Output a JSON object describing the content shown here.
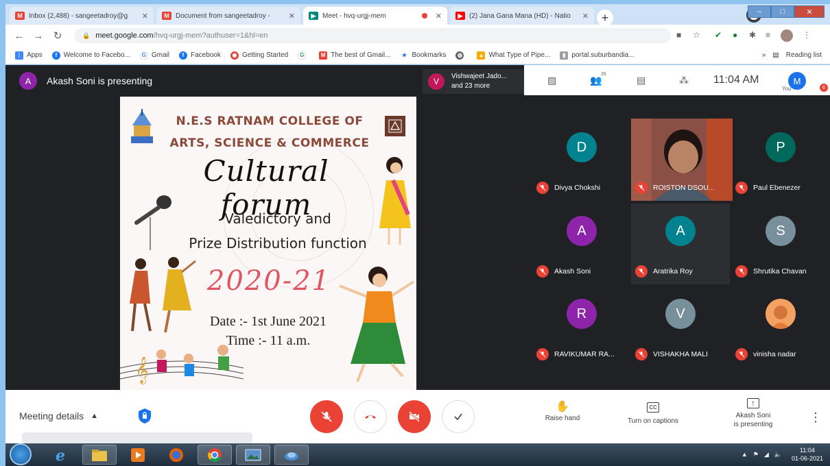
{
  "browser": {
    "tabs": [
      {
        "label": "Inbox (2,488) - sangeetadroy@g",
        "icon": "gmail-icon",
        "color": "#ea4335",
        "active": false
      },
      {
        "label": "Document from sangeetadroy -",
        "icon": "gmail-icon",
        "color": "#ea4335",
        "active": false
      },
      {
        "label": "Meet - hvq-urgj-mem",
        "icon": "meet-icon",
        "color": "#00897b",
        "active": true
      },
      {
        "label": "(2) Jana Gana Mana (HD) - Natio",
        "icon": "youtube-icon",
        "color": "#ff0000",
        "active": false
      }
    ],
    "url_host": "meet.google.com",
    "url_path": "/hvq-urgj-mem?authuser=1&hl=en",
    "bookmarks": [
      {
        "label": "Apps",
        "icon": "apps-icon",
        "color": "#4285f4"
      },
      {
        "label": "Welcome to Facebo...",
        "icon": "facebook-icon",
        "color": "#1877f2"
      },
      {
        "label": "Gmail",
        "icon": "google-icon",
        "color": "#4285f4"
      },
      {
        "label": "Facebook",
        "icon": "facebook-icon",
        "color": "#1877f2"
      },
      {
        "label": "Getting Started",
        "icon": "chrome-icon",
        "color": "#db4437"
      },
      {
        "label": "",
        "icon": "google-icon",
        "color": "#34a853"
      },
      {
        "label": "The best of Gmail...",
        "icon": "gmail-icon",
        "color": "#ea4335"
      },
      {
        "label": "Bookmarks",
        "icon": "star-icon",
        "color": "#1a73e8"
      },
      {
        "label": "",
        "icon": "globe-icon",
        "color": "#5f6368"
      },
      {
        "label": "What Type of Pipe...",
        "icon": "pipe-icon",
        "color": "#f9ab00"
      },
      {
        "label": "portal.suburbandia...",
        "icon": "portal-icon",
        "color": "#9aa0a6"
      }
    ],
    "reading_list": "Reading list"
  },
  "meet": {
    "presenter": {
      "initial": "A",
      "text": "Akash Soni is presenting",
      "color": "#8e24aa"
    },
    "others": {
      "initial": "V",
      "line1": "Vishwajeet Jado...",
      "line2": "and 23 more"
    },
    "participant_count": "26",
    "time": "11:04 AM",
    "you_initial": "M",
    "you_label": "You",
    "badge": "6",
    "slide": {
      "college_line1": "N.E.S RATNAM COLLEGE OF",
      "college_line2": "ARTS, SCIENCE & COMMERCE",
      "title": "Cultural forum",
      "subtitle_line1": "Valedictory and",
      "subtitle_line2": "Prize Distribution function",
      "year": "2020-21",
      "date": "Date :- 1st June 2021",
      "time": "Time :- 11 a.m."
    },
    "participants": [
      {
        "initial": "D",
        "name": "Divya Chokshi",
        "color": "#00838f",
        "video": false
      },
      {
        "initial": "",
        "name": "ROISTON DSOU...",
        "color": "#7a4a40",
        "video": true
      },
      {
        "initial": "P",
        "name": "Paul Ebenezer",
        "color": "#00695c",
        "video": false
      },
      {
        "initial": "A",
        "name": "Akash Soni",
        "color": "#8e24aa",
        "video": false
      },
      {
        "initial": "A",
        "name": "Aratrika Roy",
        "color": "#00838f",
        "video": false
      },
      {
        "initial": "S",
        "name": "Shrutika Chavan",
        "color": "#78909c",
        "video": false
      },
      {
        "initial": "R",
        "name": "RAVIKUMAR RA...",
        "color": "#8e24aa",
        "video": false
      },
      {
        "initial": "V",
        "name": "VISHAKHA MALI",
        "color": "#78909c",
        "video": false
      },
      {
        "initial": "",
        "name": "vinisha nadar",
        "color": "#f4a261",
        "video": false
      }
    ]
  },
  "controls": {
    "meeting_details": "Meeting details",
    "raise_hand": "Raise hand",
    "captions": "Turn on captions",
    "presenting_line1": "Akash Soni",
    "presenting_line2": "is presenting"
  },
  "taskbar": {
    "clock_time": "11:04",
    "clock_date": "01-06-2021"
  }
}
